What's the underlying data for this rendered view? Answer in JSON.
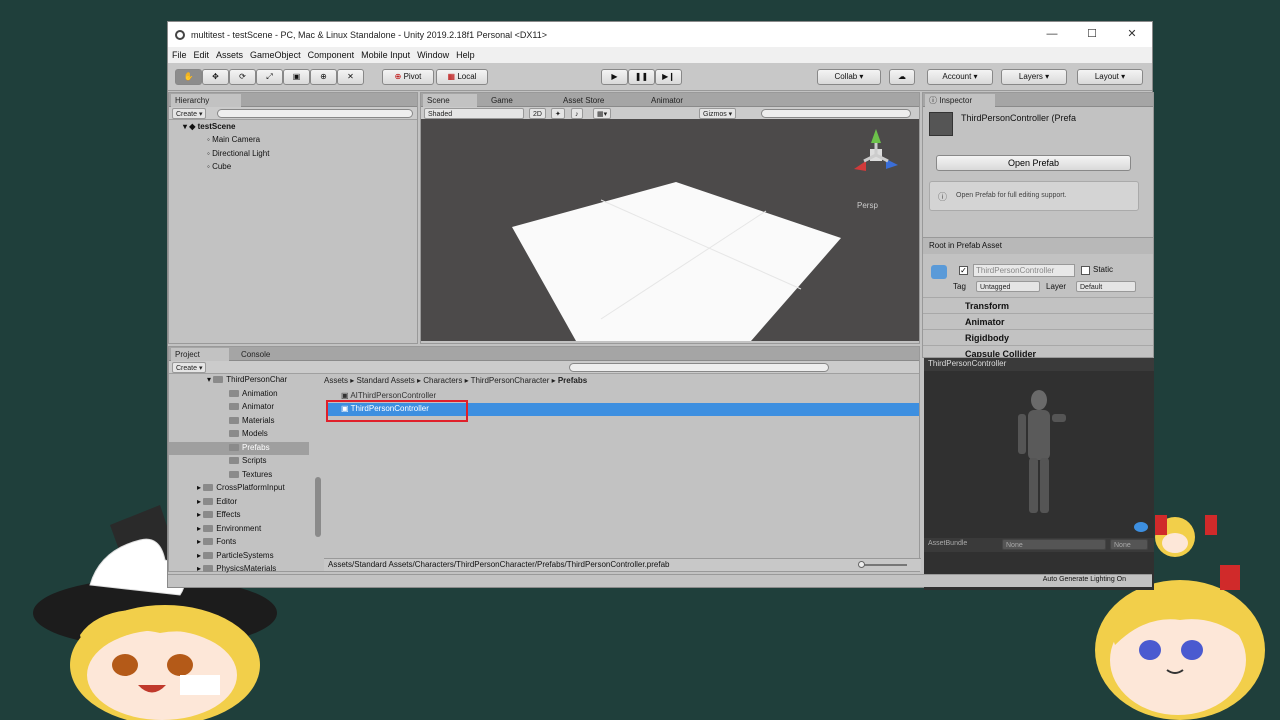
{
  "window": {
    "title": "multitest - testScene - PC, Mac & Linux Standalone - Unity 2019.2.18f1 Personal <DX11>",
    "minimize": "—",
    "maximize": "☐",
    "close": "✕"
  },
  "menu": [
    "File",
    "Edit",
    "Assets",
    "GameObject",
    "Component",
    "Mobile Input",
    "Window",
    "Help"
  ],
  "toolbar": {
    "pivot": "Pivot",
    "local": "Local",
    "collab": "Collab ▾",
    "account": "Account ▾",
    "layers": "Layers ▾",
    "layout": "Layout ▾"
  },
  "hierarchy": {
    "tab": "Hierarchy",
    "create": "Create ▾",
    "search_placeholder": "All",
    "scene": "testScene",
    "items": [
      "Main Camera",
      "Directional Light",
      "Cube"
    ]
  },
  "scene": {
    "tabs": [
      "Scene",
      "Game",
      "Asset Store",
      "Animator"
    ],
    "shading": "Shaded",
    "mode2d": "2D",
    "gizmos": "Gizmos ▾",
    "search_placeholder": "All",
    "persp": "Persp"
  },
  "inspector": {
    "tab": "Inspector",
    "object_name": "ThirdPersonController (Prefa",
    "open_prefab": "Open Prefab",
    "info": "Open Prefab for full editing support.",
    "root_label": "Root in Prefab Asset",
    "name_field": "ThirdPersonController",
    "static": "Static",
    "tag_label": "Tag",
    "tag_value": "Untagged",
    "layer_label": "Layer",
    "layer_value": "Default",
    "components": [
      "Transform",
      "Animator",
      "Rigidbody",
      "Capsule Collider"
    ]
  },
  "project": {
    "tabs": [
      "Project",
      "Console"
    ],
    "create": "Create ▾",
    "breadcrumb": [
      "Assets",
      "Standard Assets",
      "Characters",
      "ThirdPersonCharacter",
      "Prefabs"
    ],
    "tree": [
      {
        "label": "ThirdPersonChar",
        "indent": 0,
        "expanded": true
      },
      {
        "label": "Animation",
        "indent": 1
      },
      {
        "label": "Animator",
        "indent": 1
      },
      {
        "label": "Materials",
        "indent": 1
      },
      {
        "label": "Models",
        "indent": 1
      },
      {
        "label": "Prefabs",
        "indent": 1,
        "selected": true
      },
      {
        "label": "Scripts",
        "indent": 1
      },
      {
        "label": "Textures",
        "indent": 1
      },
      {
        "label": "CrossPlatformInput",
        "indent": -1
      },
      {
        "label": "Editor",
        "indent": -1
      },
      {
        "label": "Effects",
        "indent": -1
      },
      {
        "label": "Environment",
        "indent": -1
      },
      {
        "label": "Fonts",
        "indent": -1
      },
      {
        "label": "ParticleSystems",
        "indent": -1
      },
      {
        "label": "PhysicsMaterials",
        "indent": -1
      }
    ],
    "files": [
      "AIThirdPersonController",
      "ThirdPersonController"
    ],
    "path": "Assets/Standard Assets/Characters/ThirdPersonCharacter/Prefabs/ThirdPersonController.prefab"
  },
  "preview": {
    "title": "ThirdPersonController",
    "assetbundle_label": "AssetBundle",
    "ab_value": "None",
    "ab_variant": "None"
  },
  "status": "Auto Generate Lighting On",
  "colors": {
    "background": "#1f3f3b",
    "selection": "#3d8fe0",
    "highlight_box": "#e0202a"
  }
}
